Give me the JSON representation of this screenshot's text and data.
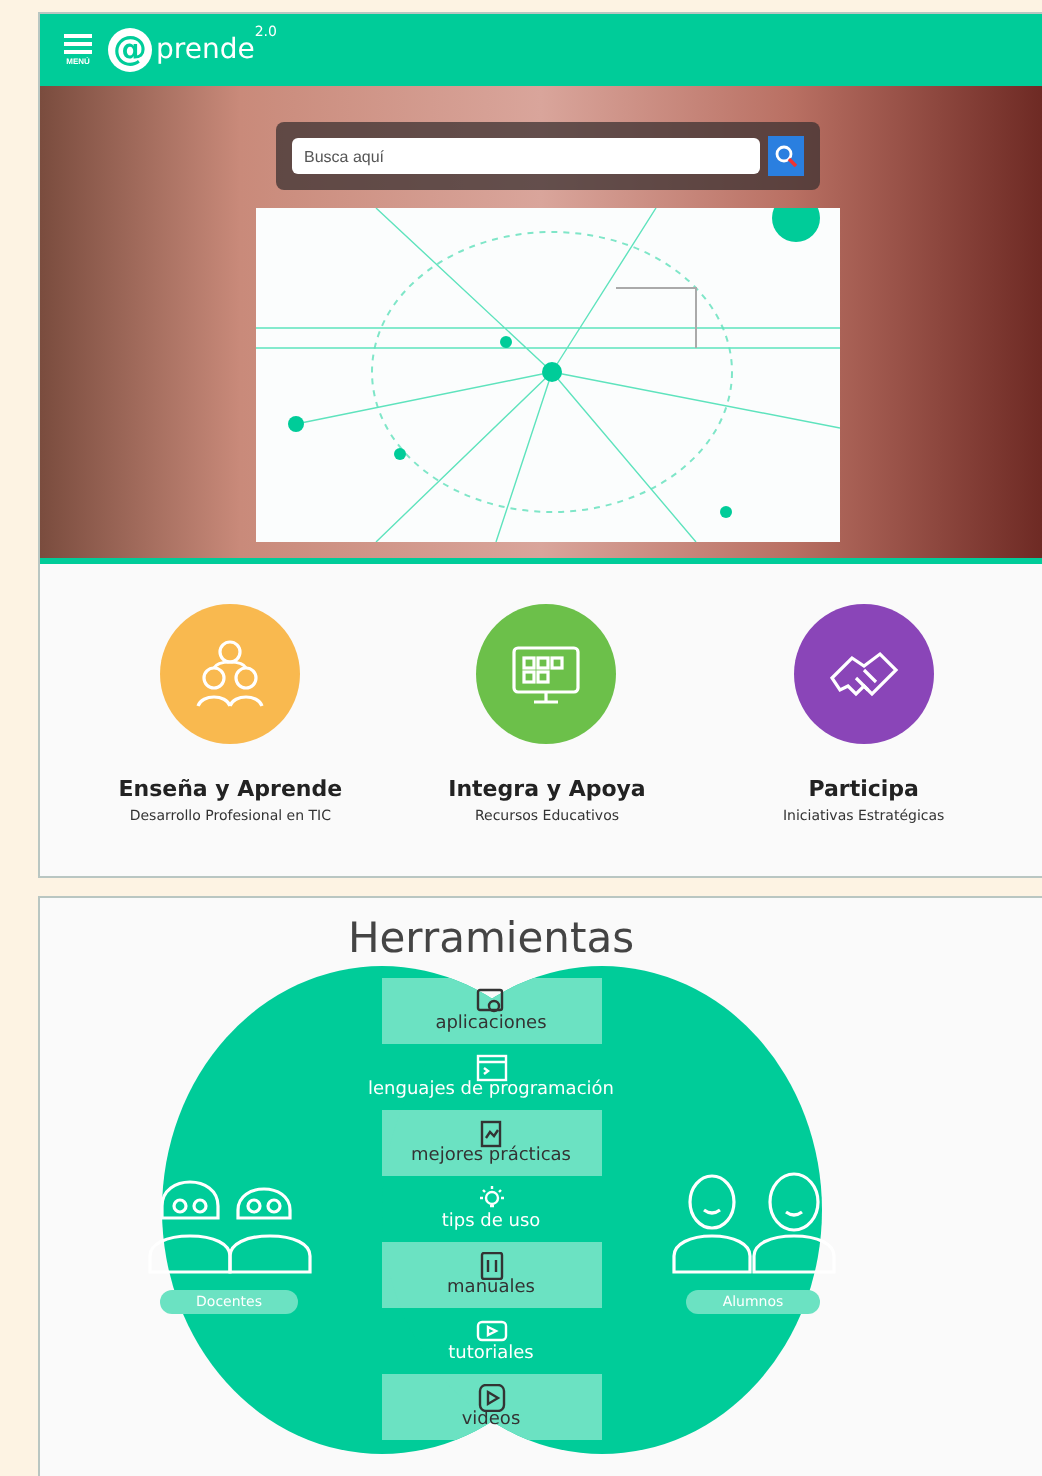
{
  "header": {
    "menu_label": "MENÚ",
    "logo_mark": "@",
    "logo_text": "prende",
    "logo_superscript": "2.0"
  },
  "hero": {
    "search": {
      "placeholder": "Busca aquí"
    }
  },
  "categories": [
    {
      "title": "Enseña y Aprende",
      "subtitle": "Desarrollo Profesional en TIC",
      "color": "#f9b94f",
      "kind": "people"
    },
    {
      "title": "Integra y Apoya",
      "subtitle": "Recursos Educativos",
      "color": "#6cc04a",
      "kind": "screen"
    },
    {
      "title": "Participa",
      "subtitle": "Iniciativas Estratégicas",
      "color": "#8a45b8",
      "kind": "handshake"
    }
  ],
  "tools": {
    "title": "Herramientas",
    "groups": [
      {
        "label": "Docentes",
        "kind": "teachers"
      },
      {
        "label": "Alumnos",
        "kind": "students"
      }
    ],
    "items": [
      {
        "label": "aplicaciones",
        "kind": "apps"
      },
      {
        "label": "lenguajes de programación",
        "kind": "code"
      },
      {
        "label": "mejores prácticas",
        "kind": "doc"
      },
      {
        "label": "tips de uso",
        "kind": "bulb"
      },
      {
        "label": "manuales",
        "kind": "book"
      },
      {
        "label": "tutoriales",
        "kind": "tutorial"
      },
      {
        "label": "videos",
        "kind": "play"
      }
    ]
  }
}
